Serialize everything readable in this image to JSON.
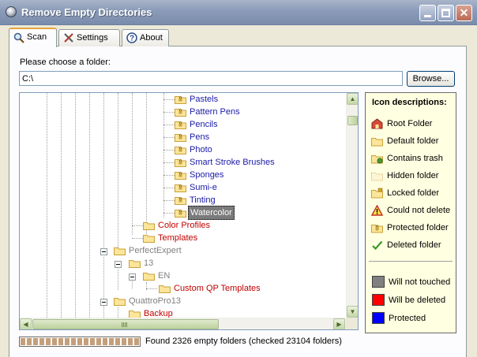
{
  "window": {
    "title": "Remove Empty Directories",
    "close_glyph": "✕"
  },
  "tabs": [
    {
      "label": "Scan",
      "icon": "magnifier-icon",
      "active": true
    },
    {
      "label": "Settings",
      "icon": "tools-icon",
      "active": false
    },
    {
      "label": "About",
      "icon": "help-icon",
      "active": false
    }
  ],
  "folder_chooser": {
    "label": "Please choose a folder:",
    "value": "C:\\",
    "browse_label": "Browse..."
  },
  "tree": {
    "rows": [
      {
        "label": "Pastels",
        "style": "blue"
      },
      {
        "label": "Pattern Pens",
        "style": "blue"
      },
      {
        "label": "Pencils",
        "style": "blue"
      },
      {
        "label": "Pens",
        "style": "blue"
      },
      {
        "label": "Photo",
        "style": "blue"
      },
      {
        "label": "Smart Stroke Brushes",
        "style": "blue"
      },
      {
        "label": "Sponges",
        "style": "blue"
      },
      {
        "label": "Sumi-e",
        "style": "blue"
      },
      {
        "label": "Tinting",
        "style": "blue"
      },
      {
        "label": "Watercolor",
        "style": "selected"
      },
      {
        "label": "Color Profiles",
        "style": "red"
      },
      {
        "label": "Templates",
        "style": "red"
      },
      {
        "label": "PerfectExpert",
        "style": "gray"
      },
      {
        "label": "13",
        "style": "gray"
      },
      {
        "label": "EN",
        "style": "gray"
      },
      {
        "label": "Custom QP Templates",
        "style": "red"
      },
      {
        "label": "QuattroPro13",
        "style": "gray"
      },
      {
        "label": "Backup",
        "style": "red"
      }
    ]
  },
  "legend": {
    "title": "Icon descriptions:",
    "icons": [
      {
        "label": "Root Folder",
        "icon": "root-folder-icon"
      },
      {
        "label": "Default folder",
        "icon": "default-folder-icon"
      },
      {
        "label": "Contains trash",
        "icon": "trash-folder-icon"
      },
      {
        "label": "Hidden folder",
        "icon": "hidden-folder-icon"
      },
      {
        "label": "Locked folder",
        "icon": "locked-folder-icon"
      },
      {
        "label": "Could not delete",
        "icon": "warning-icon"
      },
      {
        "label": "Protected folder",
        "icon": "protected-folder-icon"
      },
      {
        "label": "Deleted folder",
        "icon": "checkmark-icon"
      }
    ],
    "colors": [
      {
        "label": "Will not touched",
        "color": "#808080"
      },
      {
        "label": "Will be deleted",
        "color": "#ff0000"
      },
      {
        "label": "Protected",
        "color": "#0000ff"
      }
    ]
  },
  "status": {
    "progress": 1.0,
    "text": "Found 2326 empty folders (checked 23104 folders)"
  }
}
